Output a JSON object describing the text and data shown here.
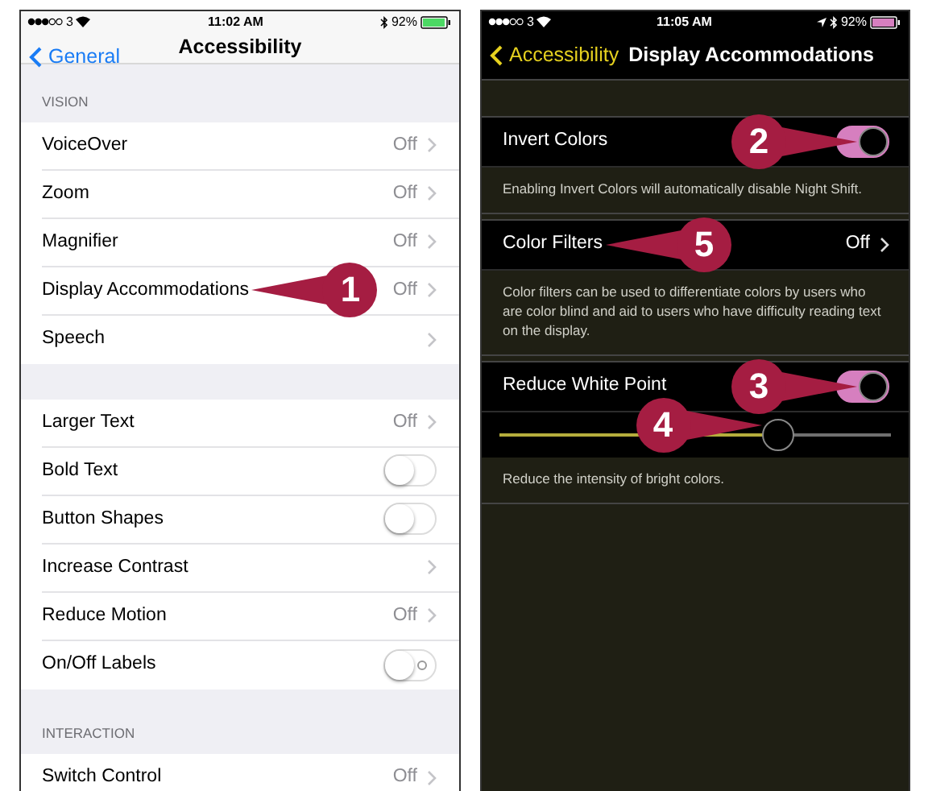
{
  "left_phone": {
    "status": {
      "carrier": "3",
      "time": "11:02 AM",
      "battery": "92%"
    },
    "nav": {
      "back": "General",
      "title": "Accessibility"
    },
    "sections": [
      {
        "header": "VISION",
        "rows": [
          {
            "label": "VoiceOver",
            "kind": "link",
            "value": "Off"
          },
          {
            "label": "Zoom",
            "kind": "link",
            "value": "Off"
          },
          {
            "label": "Magnifier",
            "kind": "link",
            "value": "Off"
          },
          {
            "label": "Display Accommodations",
            "kind": "link",
            "value": "Off",
            "callout": "1"
          },
          {
            "label": "Speech",
            "kind": "link"
          }
        ]
      },
      {
        "rows": [
          {
            "label": "Larger Text",
            "kind": "link",
            "value": "Off"
          },
          {
            "label": "Bold Text",
            "kind": "toggle",
            "on": false,
            "label_mark": false
          },
          {
            "label": "Button Shapes",
            "kind": "toggle",
            "on": false,
            "label_mark": false
          },
          {
            "label": "Increase Contrast",
            "kind": "link"
          },
          {
            "label": "Reduce Motion",
            "kind": "link",
            "value": "Off"
          },
          {
            "label": "On/Off Labels",
            "kind": "toggle",
            "on": false,
            "label_mark": true
          }
        ]
      },
      {
        "header": "INTERACTION",
        "rows": [
          {
            "label": "Switch Control",
            "kind": "link",
            "value": "Off"
          }
        ]
      }
    ]
  },
  "right_phone": {
    "status": {
      "carrier": "3",
      "time": "11:05 AM",
      "battery": "92%"
    },
    "nav": {
      "back": "Accessibility",
      "title": "Display Accommodations"
    },
    "groups": [
      {
        "rows": [
          {
            "label": "Invert Colors",
            "kind": "toggle",
            "on": true,
            "callout": "2"
          }
        ],
        "footer": "Enabling Invert Colors will automatically disable Night Shift."
      },
      {
        "rows": [
          {
            "label": "Color Filters",
            "kind": "link",
            "value": "Off",
            "callout": "5"
          }
        ],
        "footer": "Color filters can be used to differentiate colors by users who are color blind and aid to users who have difficulty reading text on the display."
      },
      {
        "rows": [
          {
            "label": "Reduce White Point",
            "kind": "toggle",
            "on": true,
            "callout": "3"
          },
          {
            "kind": "slider",
            "level": 0.71,
            "callout": "4"
          }
        ],
        "footer": "Reduce the intensity of bright colors."
      }
    ]
  }
}
